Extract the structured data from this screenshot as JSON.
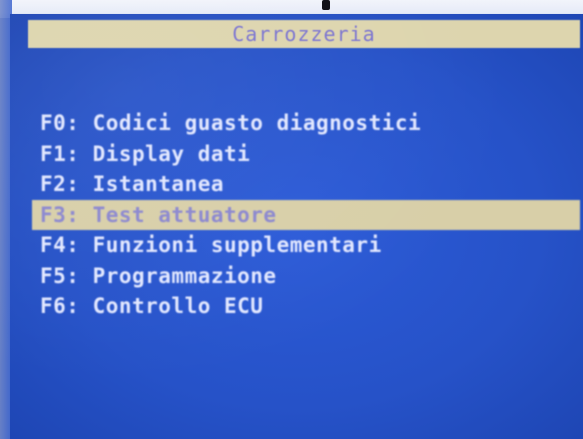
{
  "window": {
    "title": "Carrozzeria"
  },
  "menu": {
    "items": [
      {
        "label": "F0: Codici guasto diagnostici",
        "selected": false
      },
      {
        "label": "F1: Display dati",
        "selected": false
      },
      {
        "label": "F2: Istantanea",
        "selected": false
      },
      {
        "label": "F3: Test attuatore",
        "selected": true
      },
      {
        "label": "F4: Funzioni supplementari",
        "selected": false
      },
      {
        "label": "F5: Programmazione",
        "selected": false
      },
      {
        "label": "F6: Controllo ECU",
        "selected": false
      }
    ]
  },
  "colors": {
    "screen_background": "#2652c8",
    "title_bar_background": "#ddd5ae",
    "title_text": "#7b74d0",
    "menu_text": "#e3e8ff",
    "selection_background": "#d8cfa8",
    "selection_text": "#8a86cf"
  }
}
